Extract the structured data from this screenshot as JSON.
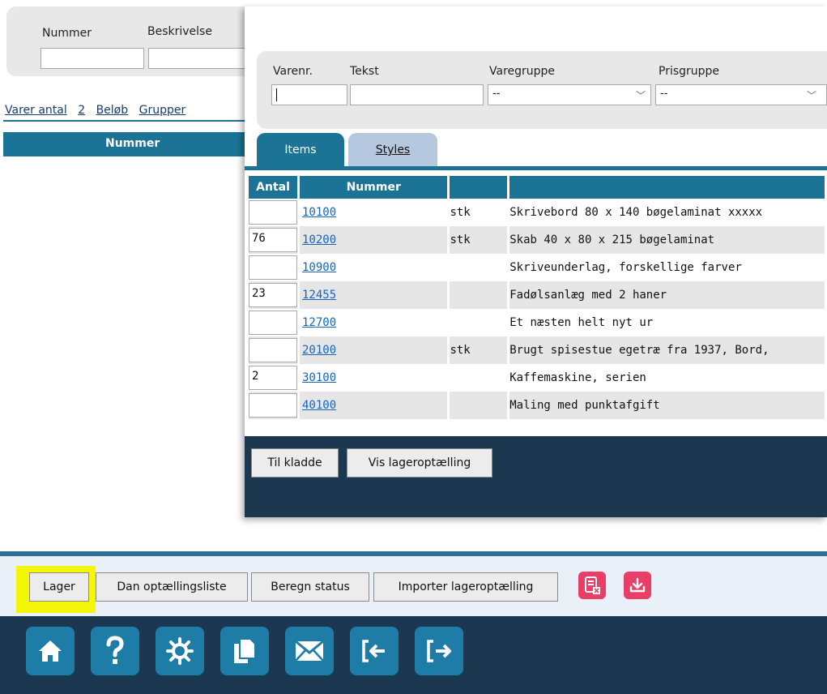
{
  "background": {
    "filter": {
      "nummer_label": "Nummer",
      "beskrivelse_label": "Beskrivelse"
    },
    "tabs": {
      "varer_antal": "Varer antal",
      "count": "2",
      "belob": "Beløb",
      "grupper": "Grupper"
    },
    "table_header": "Nummer"
  },
  "modal": {
    "filter": {
      "varenr_label": "Varenr.",
      "tekst_label": "Tekst",
      "varegruppe_label": "Varegruppe",
      "varegruppe_value": "--",
      "prisgruppe_label": "Prisgruppe",
      "prisgruppe_value": "--"
    },
    "tabs": [
      {
        "label": "Items"
      },
      {
        "label": "Styles"
      }
    ],
    "columns": {
      "antal": "Antal",
      "nummer": "Nummer"
    },
    "rows": [
      {
        "antal": "",
        "nummer": "10100",
        "enhed": "stk",
        "tekst": "Skrivebord 80 x 140 bøgelaminat xxxxx"
      },
      {
        "antal": "76",
        "nummer": "10200",
        "enhed": "stk",
        "tekst": "Skab 40 x 80 x 215 bøgelaminat"
      },
      {
        "antal": "",
        "nummer": "10900",
        "enhed": "",
        "tekst": "Skriveunderlag, forskellige farver"
      },
      {
        "antal": "23",
        "nummer": "12455",
        "enhed": "",
        "tekst": "Fadølsanlæg med 2 haner"
      },
      {
        "antal": "",
        "nummer": "12700",
        "enhed": "",
        "tekst": "Et næsten helt nyt ur"
      },
      {
        "antal": "",
        "nummer": "20100",
        "enhed": "stk",
        "tekst": "Brugt spisestue egetræ fra 1937, Bord,"
      },
      {
        "antal": "2",
        "nummer": "30100",
        "enhed": "",
        "tekst": "Kaffemaskine, serien"
      },
      {
        "antal": "",
        "nummer": "40100",
        "enhed": "",
        "tekst": "Maling med punktafgift"
      }
    ],
    "buttons": {
      "til_kladde": "Til kladde",
      "vis_lageroptaelling": "Vis lageroptælling"
    }
  },
  "bottom": {
    "buttons": {
      "lager": "Lager",
      "dan_optaellingsliste": "Dan optællingsliste",
      "beregn_status": "Beregn status",
      "importer_lageroptaelling": "Importer lageroptælling"
    },
    "nav_icons": [
      "home-icon",
      "help-icon",
      "settings-icon",
      "copy-icon",
      "mail-icon",
      "login-icon",
      "logout-icon"
    ]
  },
  "colors": {
    "teal": "#1b7395",
    "navy": "#1b3850",
    "nav_button": "#1e7da6",
    "pink": "#ea3e67",
    "highlight": "#f5f50a"
  }
}
